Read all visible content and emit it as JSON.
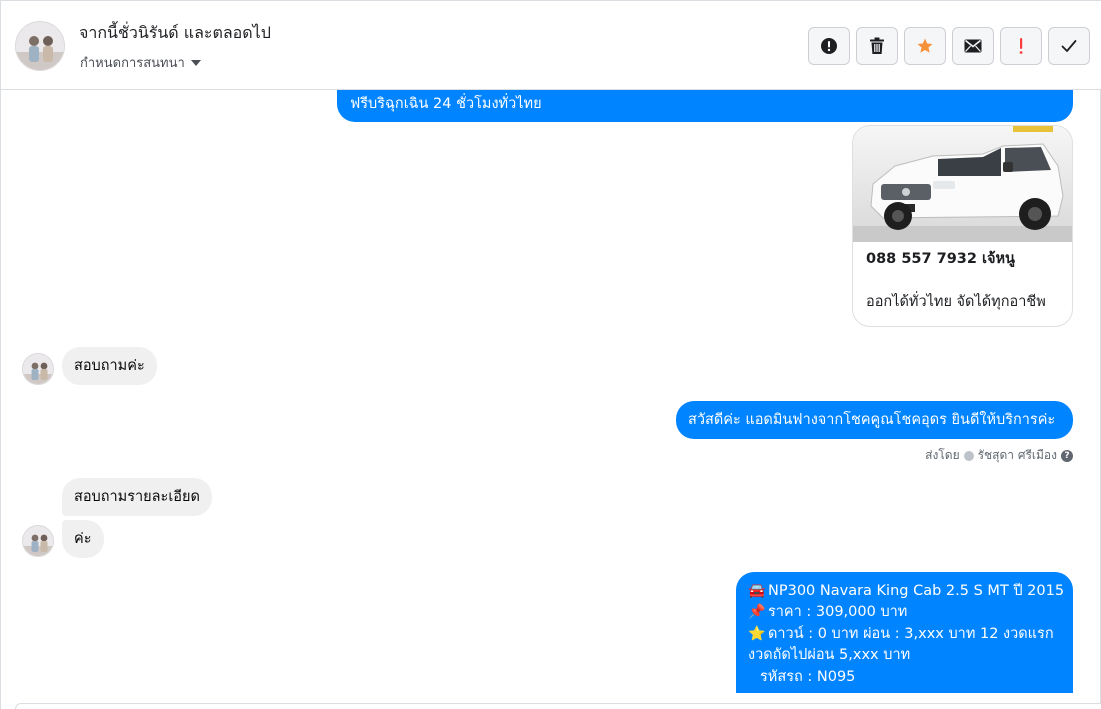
{
  "header": {
    "name": "จากนี้ชั่วนิรันด์ และตลอดไป",
    "subtitle": "กำหนดการสนทนา",
    "actions": [
      {
        "id": "report",
        "icon": "exclamation-circle-icon"
      },
      {
        "id": "delete",
        "icon": "trash-icon"
      },
      {
        "id": "star",
        "icon": "star-icon"
      },
      {
        "id": "mark-unread",
        "icon": "envelope-icon"
      },
      {
        "id": "spam",
        "icon": "exclamation-icon"
      },
      {
        "id": "done",
        "icon": "check-icon"
      }
    ]
  },
  "colors": {
    "outgoing": "#0084ff",
    "incoming": "#f0f0f0",
    "star": "#f7923a",
    "spam": "#fa3e3e"
  },
  "messages": {
    "m1": "ฟรีบริฉุกเฉิน 24 ชั่วโมงทั่วไทย",
    "card": {
      "title": "088 557 7932 เจ้หนู",
      "desc": "ออกได้ทั่วไทย จัดได้ทุกอาชีพ"
    },
    "m2": "สอบถามค่ะ",
    "m3": "สวัสดีค่ะ แอดมินฟางจากโชคคูณโชคอุดร ยินดีให้บริการค่ะ",
    "sent_by": {
      "prefix": "ส่งโดย",
      "name": "รัชสุดา ศรีเมือง"
    },
    "m4": "สอบถามรายละเอียด",
    "m5": "ค่ะ",
    "m6": {
      "line1": "NP300 Navara King Cab 2.5 S MT ปี 2015",
      "line2": "ราคา : 309,000 บาท",
      "line3": "ดาวน์ : 0 บาท ผ่อน : 3,xxx บาท 12 งวดแรก",
      "line4": "งวดถัดไปผ่อน  5,xxx บาท",
      "line5": "รหัสรถ : N095"
    }
  }
}
